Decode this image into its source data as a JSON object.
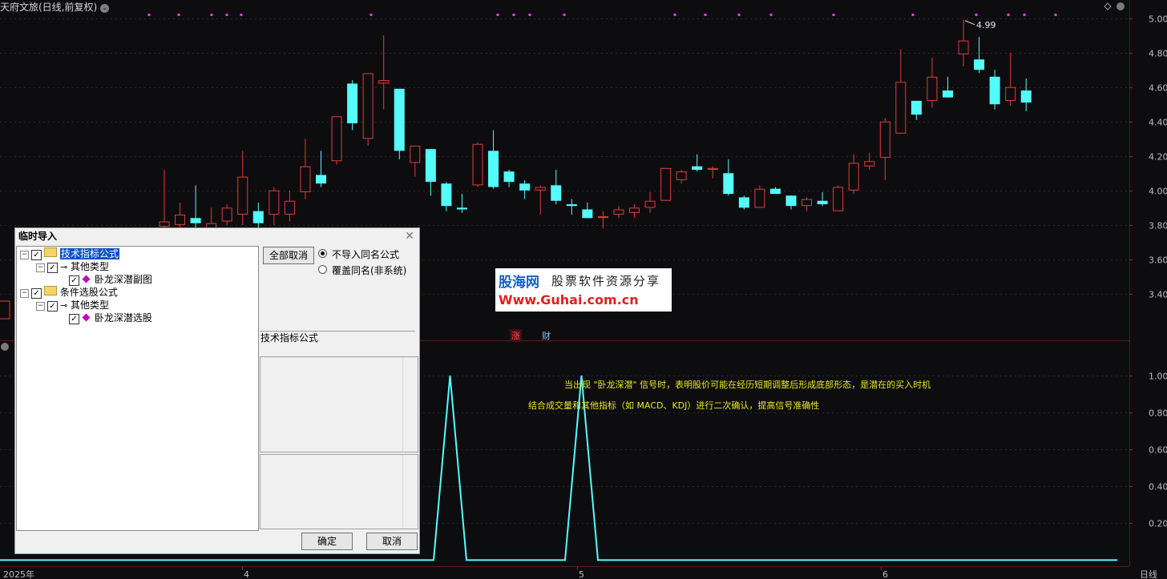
{
  "window": {
    "title": "天府文旅(日线,前复权)"
  },
  "chart_data": [
    {
      "type": "candlestick",
      "ylim": [
        3.2,
        5.04
      ],
      "yticks": [
        "5.00",
        "4.80",
        "4.60",
        "4.40",
        "4.20",
        "4.00",
        "3.80",
        "3.60",
        "3.40"
      ],
      "ytick_values": [
        5.0,
        4.8,
        4.6,
        4.4,
        4.2,
        4.0,
        3.8,
        3.6,
        3.4
      ],
      "max_label": "4.99",
      "up_color": "#e03c3c",
      "down_color": "#54fcfc",
      "candles": [
        {
          "o": 3.79,
          "c": 3.82,
          "h": 4.12,
          "l": 3.72
        },
        {
          "o": 3.8,
          "c": 3.86,
          "h": 3.93,
          "l": 3.74
        },
        {
          "o": 3.84,
          "c": 3.81,
          "h": 4.03,
          "l": 3.76
        },
        {
          "o": 3.78,
          "c": 3.81,
          "h": 3.9,
          "l": 3.74
        },
        {
          "o": 3.82,
          "c": 3.9,
          "h": 3.92,
          "l": 3.8
        },
        {
          "o": 3.86,
          "c": 4.08,
          "h": 4.23,
          "l": 3.8
        },
        {
          "o": 3.88,
          "c": 3.81,
          "h": 3.93,
          "l": 3.75
        },
        {
          "o": 3.86,
          "c": 4.0,
          "h": 4.02,
          "l": 3.8
        },
        {
          "o": 3.86,
          "c": 3.94,
          "h": 4.0,
          "l": 3.82
        },
        {
          "o": 3.99,
          "c": 4.14,
          "h": 4.3,
          "l": 3.95
        },
        {
          "o": 4.09,
          "c": 4.04,
          "h": 4.23,
          "l": 4.02
        },
        {
          "o": 4.17,
          "c": 4.43,
          "h": 4.43,
          "l": 4.15
        },
        {
          "o": 4.62,
          "c": 4.39,
          "h": 4.64,
          "l": 4.35
        },
        {
          "o": 4.3,
          "c": 4.68,
          "h": 4.68,
          "l": 4.26
        },
        {
          "o": 4.62,
          "c": 4.64,
          "h": 4.9,
          "l": 4.47
        },
        {
          "o": 4.59,
          "c": 4.23,
          "h": 4.59,
          "l": 4.18
        },
        {
          "o": 4.16,
          "c": 4.26,
          "h": 4.26,
          "l": 4.08
        },
        {
          "o": 4.24,
          "c": 4.05,
          "h": 4.24,
          "l": 3.97
        },
        {
          "o": 4.04,
          "c": 3.91,
          "h": 4.05,
          "l": 3.88
        },
        {
          "o": 3.9,
          "c": 3.89,
          "h": 3.98,
          "l": 3.87
        },
        {
          "o": 4.03,
          "c": 4.27,
          "h": 4.28,
          "l": 4.02
        },
        {
          "o": 4.23,
          "c": 4.02,
          "h": 4.35,
          "l": 4.01
        },
        {
          "o": 4.11,
          "c": 4.05,
          "h": 4.12,
          "l": 4.02
        },
        {
          "o": 4.04,
          "c": 4.0,
          "h": 4.06,
          "l": 3.95
        },
        {
          "o": 4.0,
          "c": 4.02,
          "h": 4.03,
          "l": 3.86
        },
        {
          "o": 4.03,
          "c": 3.94,
          "h": 4.12,
          "l": 3.92
        },
        {
          "o": 3.92,
          "c": 3.91,
          "h": 3.95,
          "l": 3.86
        },
        {
          "o": 3.89,
          "c": 3.84,
          "h": 3.93,
          "l": 3.84
        },
        {
          "o": 3.85,
          "c": 3.85,
          "h": 3.88,
          "l": 3.78
        },
        {
          "o": 3.86,
          "c": 3.89,
          "h": 3.91,
          "l": 3.84
        },
        {
          "o": 3.87,
          "c": 3.9,
          "h": 3.92,
          "l": 3.84
        },
        {
          "o": 3.9,
          "c": 3.94,
          "h": 3.99,
          "l": 3.87
        },
        {
          "o": 3.94,
          "c": 4.13,
          "h": 4.13,
          "l": 3.94
        },
        {
          "o": 4.06,
          "c": 4.11,
          "h": 4.12,
          "l": 4.04
        },
        {
          "o": 4.14,
          "c": 4.12,
          "h": 4.21,
          "l": 4.11
        },
        {
          "o": 4.12,
          "c": 4.13,
          "h": 4.14,
          "l": 4.07
        },
        {
          "o": 4.1,
          "c": 3.98,
          "h": 4.18,
          "l": 3.97
        },
        {
          "o": 3.96,
          "c": 3.9,
          "h": 3.97,
          "l": 3.89
        },
        {
          "o": 3.9,
          "c": 4.01,
          "h": 4.03,
          "l": 3.9
        },
        {
          "o": 4.01,
          "c": 3.98,
          "h": 4.02,
          "l": 3.98
        },
        {
          "o": 3.97,
          "c": 3.91,
          "h": 3.97,
          "l": 3.89
        },
        {
          "o": 3.91,
          "c": 3.95,
          "h": 3.96,
          "l": 3.88
        },
        {
          "o": 3.94,
          "c": 3.92,
          "h": 3.99,
          "l": 3.91
        },
        {
          "o": 3.88,
          "c": 4.02,
          "h": 4.03,
          "l": 3.88
        },
        {
          "o": 4.0,
          "c": 4.16,
          "h": 4.21,
          "l": 3.98
        },
        {
          "o": 4.14,
          "c": 4.17,
          "h": 4.22,
          "l": 4.12
        },
        {
          "o": 4.19,
          "c": 4.4,
          "h": 4.42,
          "l": 4.06
        },
        {
          "o": 4.33,
          "c": 4.63,
          "h": 4.82,
          "l": 4.33
        },
        {
          "o": 4.52,
          "c": 4.44,
          "h": 4.52,
          "l": 4.41
        },
        {
          "o": 4.52,
          "c": 4.66,
          "h": 4.77,
          "l": 4.48
        },
        {
          "o": 4.58,
          "c": 4.54,
          "h": 4.66,
          "l": 4.54
        },
        {
          "o": 4.79,
          "c": 4.87,
          "h": 4.99,
          "l": 4.72
        },
        {
          "o": 4.76,
          "c": 4.7,
          "h": 4.89,
          "l": 4.68
        },
        {
          "o": 4.66,
          "c": 4.5,
          "h": 4.7,
          "l": 4.47
        },
        {
          "o": 4.52,
          "c": 4.6,
          "h": 4.8,
          "l": 4.49
        },
        {
          "o": 4.58,
          "c": 4.51,
          "h": 4.65,
          "l": 4.46
        }
      ]
    },
    {
      "type": "line",
      "yticks": [
        "1.00",
        "0.80",
        "0.60",
        "0.40",
        "0.20"
      ],
      "ytick_values": [
        1.0,
        0.8,
        0.6,
        0.4,
        0.2
      ],
      "ylim": [
        -0.02,
        1.1
      ],
      "color": "#54fcfc",
      "series_points": [
        [
          0,
          0
        ],
        [
          13.0,
          0
        ],
        [
          14.0,
          1
        ],
        [
          15.0,
          0
        ],
        [
          21.0,
          0
        ],
        [
          22.0,
          1
        ],
        [
          23.0,
          0
        ],
        [
          34.2,
          0
        ]
      ]
    }
  ],
  "x_axis": {
    "labels": [
      "2025年",
      "4",
      "5",
      "6"
    ]
  },
  "period_label": "日线",
  "tags": {
    "zhang": "涨",
    "cai": "财"
  },
  "annotations": [
    "当出现 \"卧龙深潜\" 信号时，表明股价可能在经历短期调整后形成底部形态，是潜在的买入时机",
    "结合成交量和其他指标（如 MACD、KDJ）进行二次确认，提高信号准确性"
  ],
  "watermark": {
    "brand": "股海网",
    "slogan": "股票软件资源分享",
    "url": "Www.Guhai.com.cn"
  },
  "dialog": {
    "title": "临时导入",
    "close": "✕",
    "tree": {
      "group1": "技术指标公式",
      "group1_child": "其他类型",
      "group1_leaf": "卧龙深潜副图",
      "group2": "条件选股公式",
      "group2_child": "其他类型",
      "group2_leaf": "卧龙深潜选股"
    },
    "cancel_all": "全部取消",
    "radio1": "不导入同名公式",
    "radio2": "覆盖同名(非系统)",
    "section_label": "技术指标公式",
    "ok": "确定",
    "cancel": "取消"
  }
}
